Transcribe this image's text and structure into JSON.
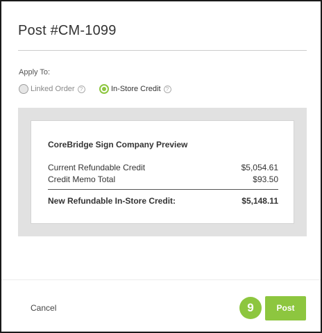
{
  "dialog": {
    "title": "Post #CM-1099"
  },
  "apply_to": {
    "label": "Apply To:",
    "options": [
      {
        "label": "Linked Order",
        "selected": false
      },
      {
        "label": "In-Store Credit",
        "selected": true
      }
    ],
    "help_glyph": "?"
  },
  "preview": {
    "title": "CoreBridge Sign Company Preview",
    "rows": [
      {
        "label": "Current Refundable Credit",
        "value": "$5,054.61"
      },
      {
        "label": "Credit Memo Total",
        "value": "$93.50"
      }
    ],
    "total": {
      "label": "New Refundable In-Store Credit:",
      "value": "$5,148.11"
    }
  },
  "footer": {
    "cancel_label": "Cancel",
    "step_number": "9",
    "post_label": "Post"
  },
  "colors": {
    "accent": "#8dc63f",
    "preview_background": "#e1e1e1"
  }
}
